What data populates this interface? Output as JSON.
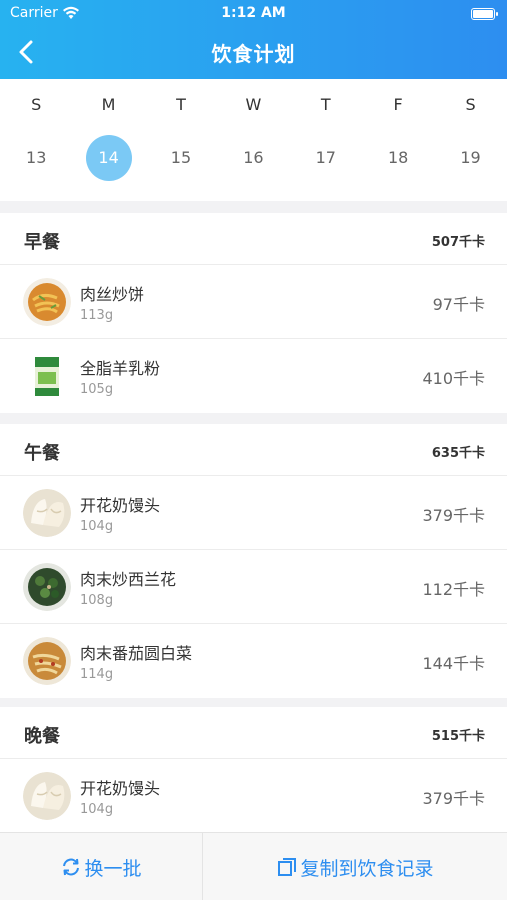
{
  "status": {
    "carrier": "Carrier",
    "time": "1:12 AM"
  },
  "header": {
    "title": "饮食计划"
  },
  "calendar": {
    "weekdays": [
      "S",
      "M",
      "T",
      "W",
      "T",
      "F",
      "S"
    ],
    "dates": [
      "13",
      "14",
      "15",
      "16",
      "17",
      "18",
      "19"
    ],
    "selected": "14"
  },
  "meals": [
    {
      "title": "早餐",
      "kcal": "507千卡",
      "items": [
        {
          "name": "肉丝炒饼",
          "weight": "113g",
          "kcal": "97千卡",
          "icon": "fried-noodle-dish"
        },
        {
          "name": "全脂羊乳粉",
          "weight": "105g",
          "kcal": "410千卡",
          "icon": "milk-powder-bag"
        }
      ]
    },
    {
      "title": "午餐",
      "kcal": "635千卡",
      "items": [
        {
          "name": "开花奶馒头",
          "weight": "104g",
          "kcal": "379千卡",
          "icon": "steamed-bun"
        },
        {
          "name": "肉末炒西兰花",
          "weight": "108g",
          "kcal": "112千卡",
          "icon": "broccoli-dish"
        },
        {
          "name": "肉末番茄圆白菜",
          "weight": "114g",
          "kcal": "144千卡",
          "icon": "cabbage-dish"
        }
      ]
    },
    {
      "title": "晚餐",
      "kcal": "515千卡",
      "items": [
        {
          "name": "开花奶馒头",
          "weight": "104g",
          "kcal": "379千卡",
          "icon": "steamed-bun"
        }
      ]
    }
  ],
  "bottom": {
    "refresh_label": "换一批",
    "copy_label": "复制到饮食记录"
  },
  "colors": {
    "accent": "#2d8ef0",
    "selected_date": "#7bc9f5"
  }
}
